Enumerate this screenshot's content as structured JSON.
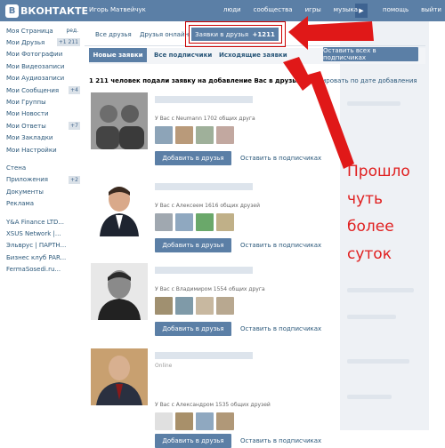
{
  "header": {
    "logo_text": "ВКОНТАКТЕ",
    "logo_letter": "В",
    "user_name": "Игорь Матвейчук",
    "nav": [
      "люди",
      "сообщества",
      "игры",
      "музыка",
      "помощь",
      "выйти"
    ]
  },
  "sidebar": {
    "items": [
      {
        "label": "Моя Страница",
        "extra": "ред."
      },
      {
        "label": "Мои Друзья",
        "count": "+1 211"
      },
      {
        "label": "Мои Фотографии"
      },
      {
        "label": "Мои Видеозаписи"
      },
      {
        "label": "Мои Аудиозаписи"
      },
      {
        "label": "Мои Сообщения",
        "count": "+4"
      },
      {
        "label": "Мои Группы"
      },
      {
        "label": "Мои Новости"
      },
      {
        "label": "Мои Ответы",
        "count": "+7"
      },
      {
        "label": "Мои Закладки"
      },
      {
        "label": "Мои Настройки"
      }
    ],
    "items2": [
      {
        "label": "Стена"
      },
      {
        "label": "Приложения",
        "count": "+2"
      },
      {
        "label": "Документы"
      },
      {
        "label": "Реклама"
      }
    ],
    "apps": [
      "Y&A Finance LTD...",
      "XSUS Network |...",
      "Эльврус | ПАРТН...",
      "Бизнес клуб PAR...",
      "FermaSosedi.ru..."
    ]
  },
  "tabs": {
    "all": "Все друзья",
    "online": "Друзья онлайн",
    "requests": "Заявки в друзья",
    "requests_count": "+1211"
  },
  "subtabs": {
    "new": "Новые заявки",
    "followers": "Все подписчики",
    "outgoing": "Исходящие заявки",
    "leave_all": "Оставить всех в подписчиках"
  },
  "summary": {
    "count_text": "1 211 человек подали заявку на добавление Вас в друзья",
    "sort_text": "Сортировать по дате добавления"
  },
  "requests": [
    {
      "mutual": "У Вас с Neumann 1702 общих друга",
      "online": ""
    },
    {
      "mutual": "У Вас с Алексеем 1616 общих друзей",
      "online": ""
    },
    {
      "mutual": "У Вас с Владимиром 1554 общих друга",
      "online": ""
    },
    {
      "mutual": "У Вас с Александром 1535 общих друзей",
      "online": "Online"
    }
  ],
  "request_actions": {
    "add": "Добавить в друзья",
    "follow": "Оставить в подписчиках"
  },
  "annotation": {
    "lines": [
      "Прошло",
      "чуть",
      "более",
      "суток"
    ]
  },
  "colors": {
    "header": "#5b7fa6",
    "link": "#2b587a",
    "annotation": "#e02020"
  }
}
